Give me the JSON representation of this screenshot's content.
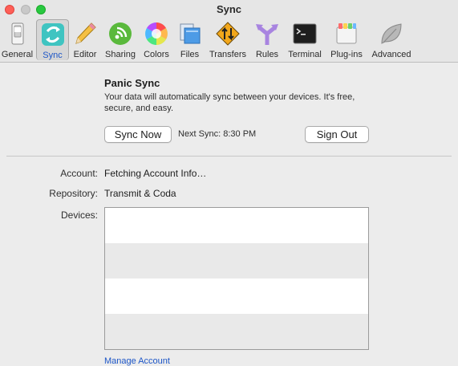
{
  "window": {
    "title": "Sync"
  },
  "toolbar": {
    "items": [
      {
        "label": "General",
        "icon": "switch-icon"
      },
      {
        "label": "Sync",
        "icon": "sync-arrows-icon",
        "selected": true
      },
      {
        "label": "Editor",
        "icon": "pencil-icon"
      },
      {
        "label": "Sharing",
        "icon": "wifi-broadcast-icon"
      },
      {
        "label": "Colors",
        "icon": "color-wheel-icon"
      },
      {
        "label": "Files",
        "icon": "folder-files-icon"
      },
      {
        "label": "Transfers",
        "icon": "transfer-sign-icon"
      },
      {
        "label": "Rules",
        "icon": "rules-arrows-icon"
      },
      {
        "label": "Terminal",
        "icon": "terminal-icon"
      },
      {
        "label": "Plug-ins",
        "icon": "plugin-box-icon"
      },
      {
        "label": "Advanced",
        "icon": "leaf-icon"
      }
    ]
  },
  "sync": {
    "title": "Panic Sync",
    "description": "Your data will automatically sync between your devices. It's free, secure, and easy.",
    "sync_now_label": "Sync Now",
    "next_sync": "Next Sync: 8:30 PM",
    "sign_out_label": "Sign Out"
  },
  "account": {
    "account_label": "Account:",
    "account_value": "Fetching Account Info…",
    "repository_label": "Repository:",
    "repository_value": "Transmit & Coda",
    "devices_label": "Devices:",
    "devices": [],
    "manage_account_label": "Manage Account"
  },
  "colors": {
    "accent": "#1d56c7",
    "close": "#fe5f57",
    "zoom": "#28c840"
  }
}
